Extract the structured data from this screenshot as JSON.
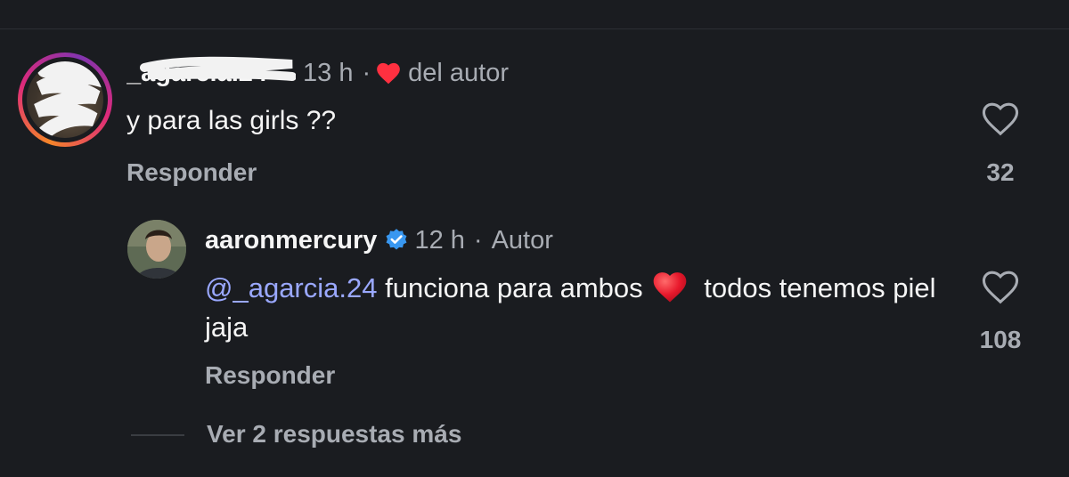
{
  "comment": {
    "username": "_agarcia.24",
    "time": "13 h",
    "separator": "·",
    "liked_by_author_label": "del autor",
    "text": "y para las girls ??",
    "reply_label": "Responder",
    "like_count": "32",
    "like_icon": "heart-outline-icon"
  },
  "reply": {
    "username": "aaronmercury",
    "verified_icon": "verified-badge-icon",
    "time": "12 h",
    "separator": "·",
    "author_label": "Autor",
    "mention": "@_agarcia.24",
    "text_part1": " funciona para ambos",
    "emoji": "red-heart-emoji",
    "text_part2": " todos tenemos piel jaja",
    "reply_label": "Responder",
    "like_count": "108",
    "like_icon": "heart-outline-icon"
  },
  "more_replies_label": "Ver 2 respuestas más",
  "colors": {
    "background": "#1a1c20",
    "text_primary": "#f5f5f5",
    "text_secondary": "#a8acb3",
    "mention": "#9aa8ff",
    "heart_red": "#ff3040",
    "verified_blue": "#3897f0"
  }
}
